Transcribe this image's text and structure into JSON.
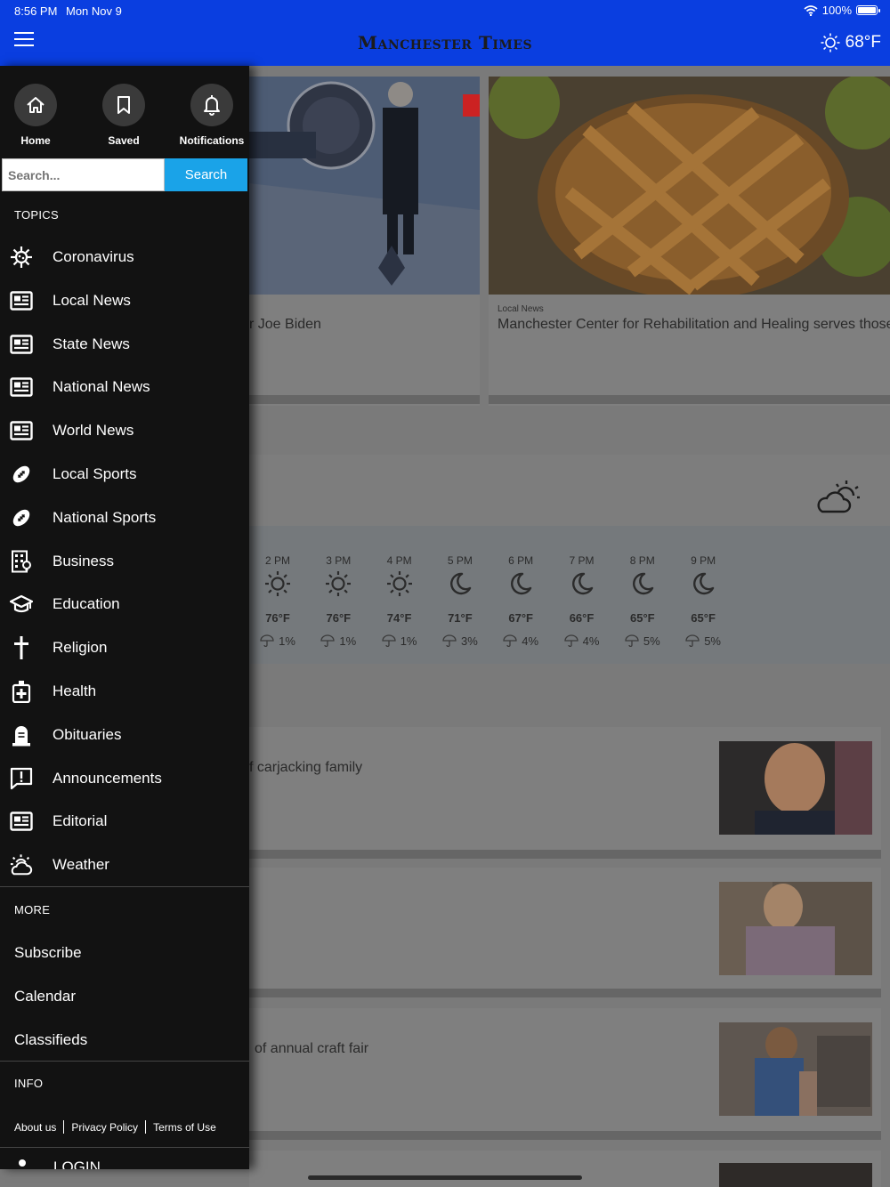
{
  "status": {
    "time": "8:56 PM",
    "date": "Mon Nov 9",
    "battery": "100%"
  },
  "header": {
    "logo": "Manchester Times",
    "temperature": "68°F"
  },
  "drawer": {
    "quick_links": [
      {
        "label": "Home",
        "icon": "home-icon"
      },
      {
        "label": "Saved",
        "icon": "bookmark-icon"
      },
      {
        "label": "Notifications",
        "icon": "bell-icon"
      }
    ],
    "search": {
      "placeholder": "Search...",
      "button": "Search"
    },
    "topics_heading": "TOPICS",
    "topics": [
      {
        "label": "Coronavirus",
        "icon": "virus-icon"
      },
      {
        "label": "Local News",
        "icon": "newspaper-icon"
      },
      {
        "label": "State News",
        "icon": "newspaper-icon"
      },
      {
        "label": "National News",
        "icon": "newspaper-icon"
      },
      {
        "label": "World News",
        "icon": "newspaper-icon"
      },
      {
        "label": "Local Sports",
        "icon": "football-icon"
      },
      {
        "label": "National Sports",
        "icon": "football-icon"
      },
      {
        "label": "Business",
        "icon": "building-icon"
      },
      {
        "label": "Education",
        "icon": "graduation-cap-icon"
      },
      {
        "label": "Religion",
        "icon": "cross-icon"
      },
      {
        "label": "Health",
        "icon": "medical-bag-icon"
      },
      {
        "label": "Obituaries",
        "icon": "headstone-icon"
      },
      {
        "label": "Announcements",
        "icon": "alert-message-icon"
      },
      {
        "label": "Editorial",
        "icon": "newspaper-icon"
      },
      {
        "label": "Weather",
        "icon": "weather-icon"
      }
    ],
    "more_heading": "MORE",
    "more": [
      "Subscribe",
      "Calendar",
      "Classifieds"
    ],
    "info_heading": "INFO",
    "info_links": [
      "About us",
      "Privacy Policy",
      "Terms of Use"
    ],
    "login": "LOGIN"
  },
  "content": {
    "article1_title_fragment": "r Joe Biden",
    "article2_category": "Local News",
    "article2_title": "Manchester Center for Rehabilitation and Healing serves those w",
    "forecast": [
      {
        "time": "2 PM",
        "icon": "sun-icon",
        "temp": "76°F",
        "precip": "1%"
      },
      {
        "time": "3 PM",
        "icon": "sun-icon",
        "temp": "76°F",
        "precip": "1%"
      },
      {
        "time": "4 PM",
        "icon": "sun-icon",
        "temp": "74°F",
        "precip": "1%"
      },
      {
        "time": "5 PM",
        "icon": "moon-icon",
        "temp": "71°F",
        "precip": "3%"
      },
      {
        "time": "6 PM",
        "icon": "moon-icon",
        "temp": "67°F",
        "precip": "4%"
      },
      {
        "time": "7 PM",
        "icon": "moon-icon",
        "temp": "66°F",
        "precip": "4%"
      },
      {
        "time": "8 PM",
        "icon": "moon-icon",
        "temp": "65°F",
        "precip": "5%"
      },
      {
        "time": "9 PM",
        "icon": "moon-icon",
        "temp": "65°F",
        "precip": "5%"
      }
    ],
    "list_titles": [
      "f carjacking family",
      "",
      "of annual craft fair"
    ]
  }
}
